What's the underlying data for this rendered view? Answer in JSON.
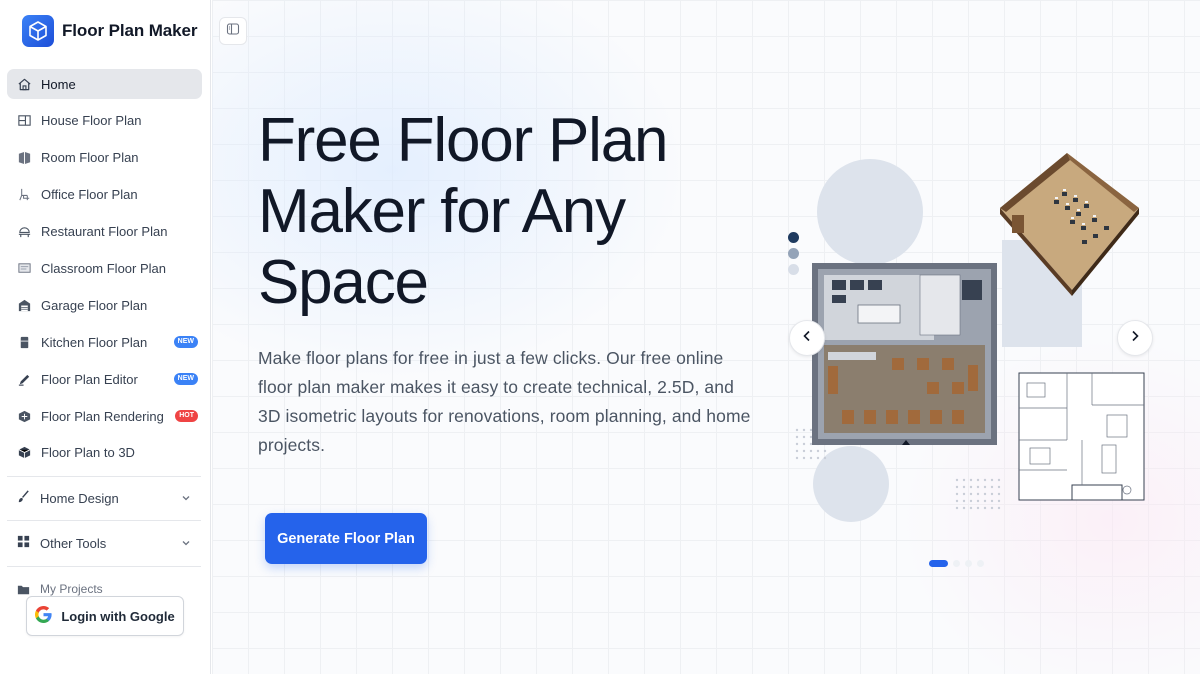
{
  "app": {
    "brand_name": "Floor Plan Maker",
    "logo_icon": "cube-logo-icon",
    "accent_color": "#2563eb"
  },
  "sidebar": {
    "items": [
      {
        "label": "Home",
        "icon": "home-icon",
        "active": true
      },
      {
        "label": "House Floor Plan",
        "icon": "house-plan-icon"
      },
      {
        "label": "Room Floor Plan",
        "icon": "room-icon"
      },
      {
        "label": "Office Floor Plan",
        "icon": "office-chair-icon"
      },
      {
        "label": "Restaurant Floor Plan",
        "icon": "restaurant-icon"
      },
      {
        "label": "Classroom Floor Plan",
        "icon": "classroom-icon"
      },
      {
        "label": "Garage Floor Plan",
        "icon": "garage-icon"
      },
      {
        "label": "Kitchen Floor Plan",
        "icon": "kitchen-icon",
        "badge": "NEW"
      },
      {
        "label": "Floor Plan Editor",
        "icon": "editor-icon",
        "badge": "NEW"
      },
      {
        "label": "Floor Plan Rendering",
        "icon": "rendering-icon",
        "badge": "HOT"
      },
      {
        "label": "Floor Plan to 3D",
        "icon": "cube-3d-icon"
      }
    ],
    "groups": [
      {
        "label": "Home Design",
        "icon": "brush-icon"
      },
      {
        "label": "Other Tools",
        "icon": "grid-icon"
      }
    ],
    "projects_label": "My Projects",
    "login_label": "Login with Google"
  },
  "hero": {
    "title": "Free Floor Plan Maker for Any Space",
    "description": "Make floor plans for free in just a few clicks. Our free online floor plan maker makes it easy to create technical, 2.5D, and 3D isometric layouts for renovations, room planning, and home projects.",
    "cta_label": "Generate Floor Plan"
  },
  "carousel": {
    "active_slide": 1,
    "slide_count": 4,
    "prev_icon": "chevron-left-icon",
    "next_icon": "chevron-right-icon"
  }
}
